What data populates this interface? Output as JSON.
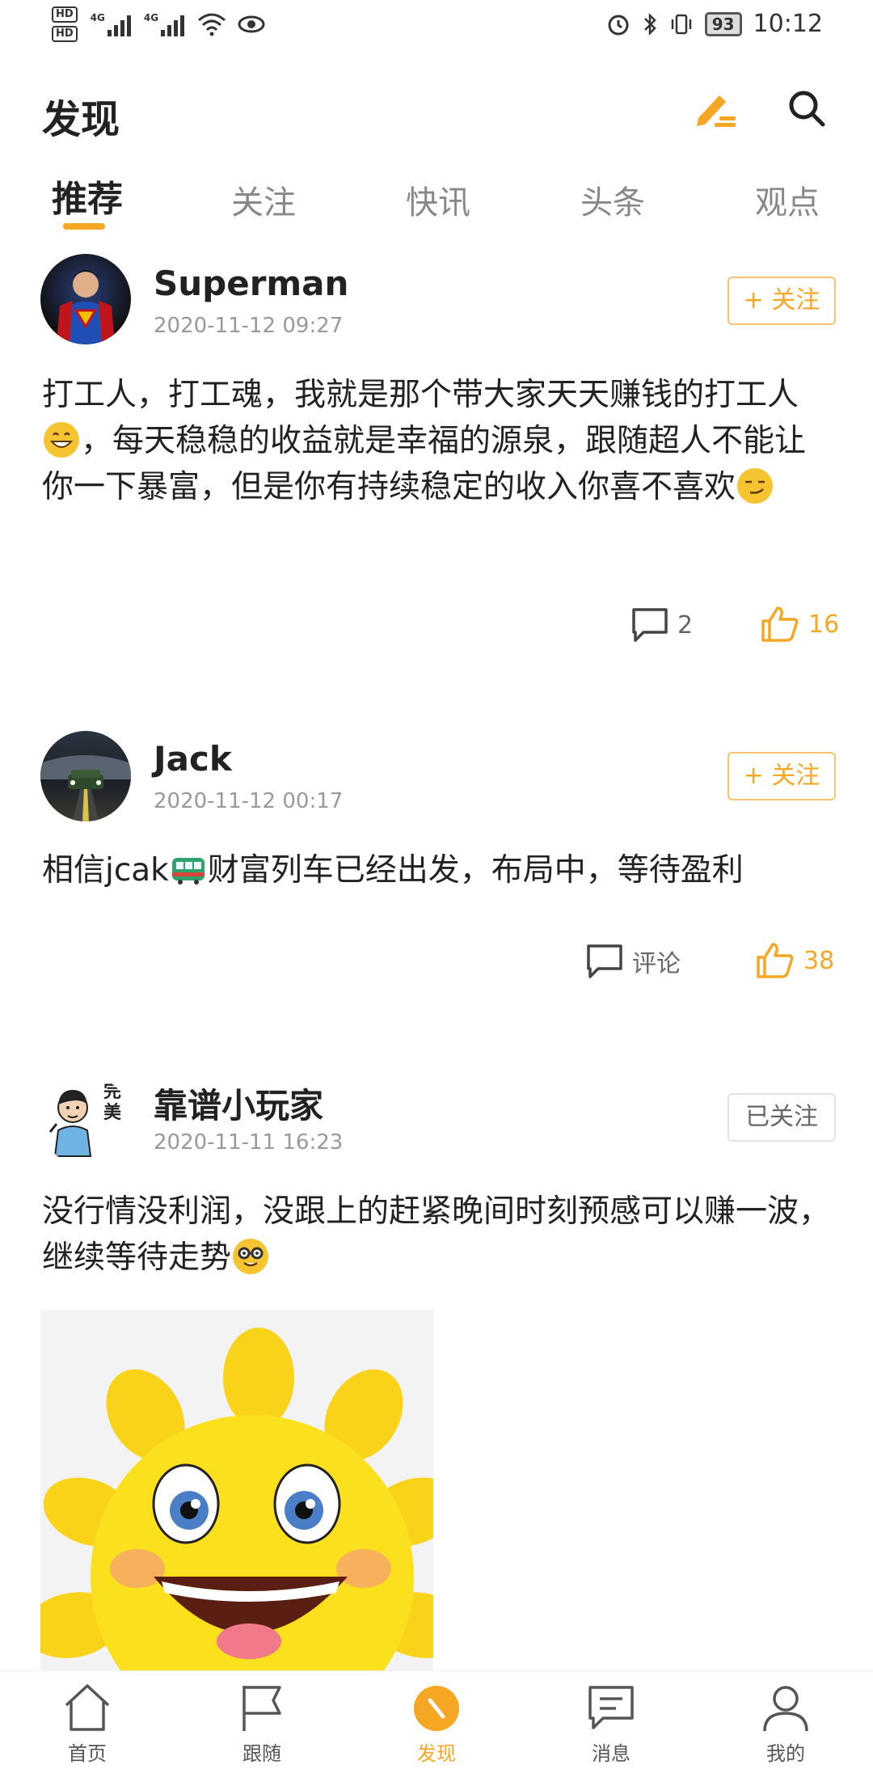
{
  "status_bar": {
    "hd_labels": [
      "HD",
      "HD"
    ],
    "signal_tags": [
      "4G",
      "4G"
    ],
    "battery": "93",
    "time": "10:12"
  },
  "header": {
    "title": "发现",
    "edit_icon": "edit-pen-icon",
    "search_icon": "search-icon"
  },
  "tabs": [
    {
      "label": "推荐",
      "active": true
    },
    {
      "label": "关注",
      "active": false
    },
    {
      "label": "快讯",
      "active": false
    },
    {
      "label": "头条",
      "active": false
    },
    {
      "label": "观点",
      "active": false
    }
  ],
  "posts": [
    {
      "username": "Superman",
      "timestamp": "2020-11-12 09:27",
      "follow_label": "+ 关注",
      "content_parts": [
        "打工人，打工魂，我就是那个带大家天天赚钱的打工人",
        "，每天稳稳的收益就是幸福的源泉，跟随超人不能让你一下暴富，但是你有持续稳定的收入你喜不喜欢"
      ],
      "comments": "2",
      "likes": "16"
    },
    {
      "username": "Jack",
      "timestamp": "2020-11-12 00:17",
      "follow_label": "+ 关注",
      "content_parts": [
        "相信jcak",
        "财富列车已经出发，布局中，等待盈利"
      ],
      "comments": "评论",
      "likes": "38"
    },
    {
      "username": "靠谱小玩家",
      "timestamp": "2020-11-11 16:23",
      "follow_label": "已关注",
      "content_parts": [
        "没行情没利润，没跟上的赶紧晚间时刻预感可以赚一波，继续等待走势"
      ],
      "avatar_text": "完美"
    }
  ],
  "bottom_nav": [
    {
      "label": "首页",
      "icon": "home-icon"
    },
    {
      "label": "跟随",
      "icon": "flag-icon"
    },
    {
      "label": "发现",
      "icon": "discover-icon",
      "active": true
    },
    {
      "label": "消息",
      "icon": "message-icon"
    },
    {
      "label": "我的",
      "icon": "profile-icon"
    }
  ],
  "colors": {
    "accent": "#f5a623",
    "text": "#222222",
    "muted": "#999999"
  }
}
